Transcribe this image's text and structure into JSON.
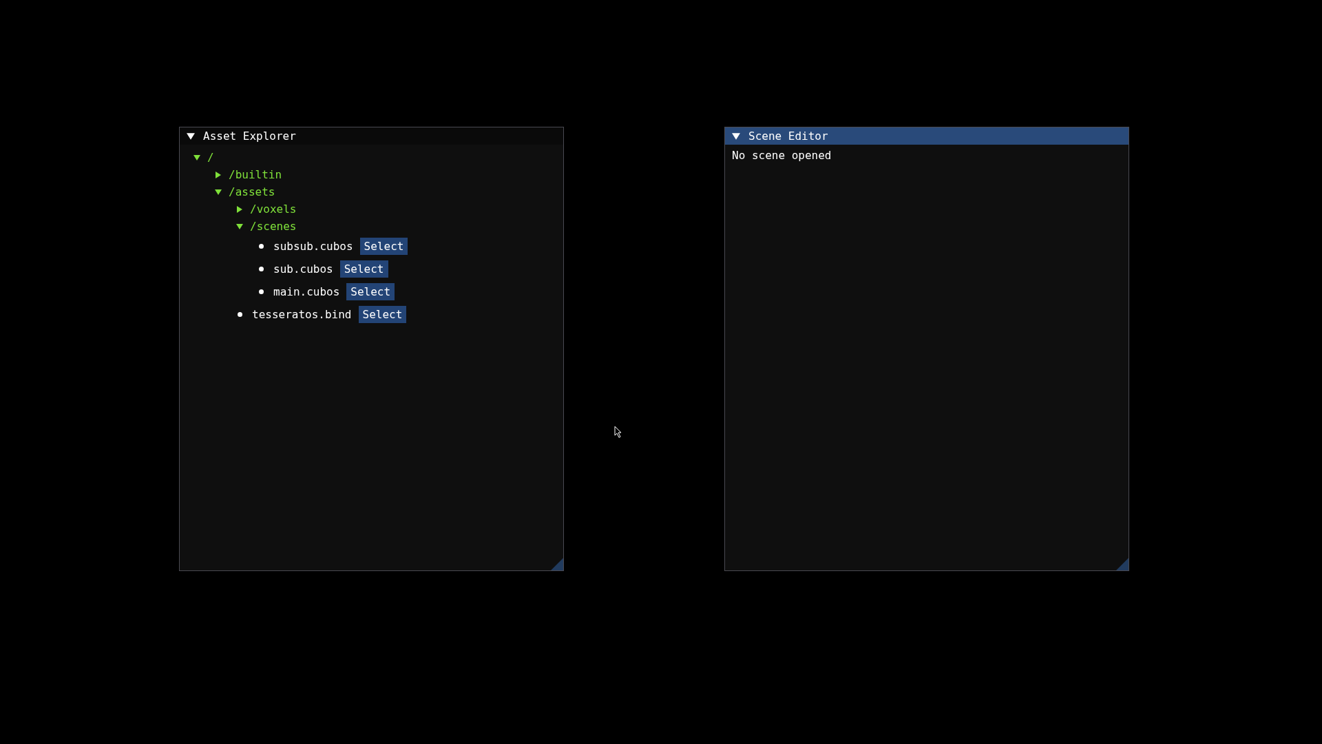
{
  "windows": [
    {
      "title": "Asset Explorer",
      "focused": false,
      "expanded": true,
      "tree": [
        {
          "kind": "folder",
          "label": "/",
          "expanded": true,
          "children": [
            {
              "kind": "folder",
              "label": "/builtin",
              "expanded": false
            },
            {
              "kind": "folder",
              "label": "/assets",
              "expanded": true,
              "children": [
                {
                  "kind": "folder",
                  "label": "/voxels",
                  "expanded": false
                },
                {
                  "kind": "folder",
                  "label": "/scenes",
                  "expanded": true,
                  "children": [
                    {
                      "kind": "file",
                      "label": "subsub.cubos",
                      "button": "Select"
                    },
                    {
                      "kind": "file",
                      "label": "sub.cubos",
                      "button": "Select"
                    },
                    {
                      "kind": "file",
                      "label": "main.cubos",
                      "button": "Select"
                    }
                  ]
                },
                {
                  "kind": "file",
                  "label": "tesseratos.bind",
                  "button": "Select"
                }
              ]
            }
          ]
        }
      ]
    },
    {
      "title": "Scene Editor",
      "focused": true,
      "expanded": true,
      "message": "No scene opened"
    }
  ]
}
